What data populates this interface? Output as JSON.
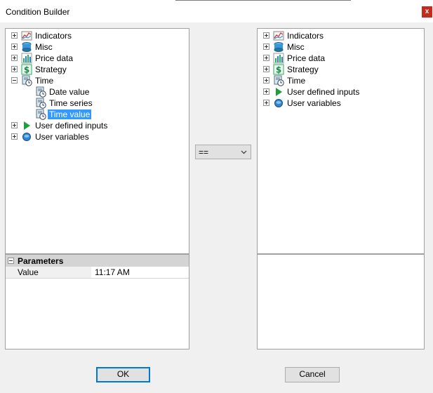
{
  "window": {
    "title": "Condition Builder",
    "close_label": "x"
  },
  "left_tree": [
    {
      "label": "Indicators",
      "icon": "indicators-icon",
      "expander": "plus",
      "selected": false
    },
    {
      "label": "Misc",
      "icon": "misc-icon",
      "expander": "plus",
      "selected": false
    },
    {
      "label": "Price data",
      "icon": "price-data-icon",
      "expander": "plus",
      "selected": false
    },
    {
      "label": "Strategy",
      "icon": "strategy-icon",
      "expander": "plus",
      "selected": false
    },
    {
      "label": "Time",
      "icon": "time-icon",
      "expander": "minus",
      "selected": false
    },
    {
      "label": "Date value",
      "icon": "time-icon",
      "child": true,
      "selected": false
    },
    {
      "label": "Time series",
      "icon": "time-icon",
      "child": true,
      "selected": false
    },
    {
      "label": "Time value",
      "icon": "time-icon",
      "child": true,
      "selected": true
    },
    {
      "label": "User defined inputs",
      "icon": "play-icon",
      "expander": "plus",
      "selected": false
    },
    {
      "label": "User variables",
      "icon": "variable-icon",
      "expander": "plus",
      "selected": false
    }
  ],
  "right_tree": [
    {
      "label": "Indicators",
      "icon": "indicators-icon",
      "expander": "plus"
    },
    {
      "label": "Misc",
      "icon": "misc-icon",
      "expander": "plus"
    },
    {
      "label": "Price data",
      "icon": "price-data-icon",
      "expander": "plus"
    },
    {
      "label": "Strategy",
      "icon": "strategy-icon",
      "expander": "plus"
    },
    {
      "label": "Time",
      "icon": "time-icon",
      "expander": "plus"
    },
    {
      "label": "User defined inputs",
      "icon": "play-icon",
      "expander": "plus"
    },
    {
      "label": "User variables",
      "icon": "variable-icon",
      "expander": "plus"
    }
  ],
  "parameters": {
    "header": "Parameters",
    "rows": [
      {
        "name": "Value",
        "value": "11:17 AM"
      }
    ]
  },
  "operator": {
    "selected": "=="
  },
  "buttons": {
    "ok": "OK",
    "cancel": "Cancel"
  },
  "colors": {
    "selection": "#3399ff",
    "close": "#c42b1c",
    "default_border": "#0078d7"
  }
}
